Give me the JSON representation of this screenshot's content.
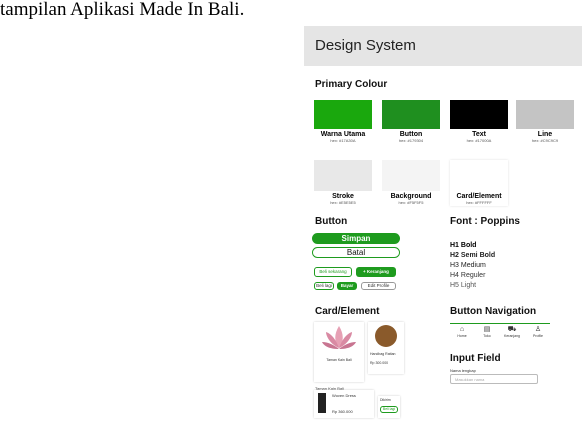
{
  "caption": "tampilan Aplikasi Made In Bali.",
  "header": {
    "title": "Design System"
  },
  "primary_colour": {
    "heading": "Primary Colour",
    "swatches": [
      {
        "name": "Warna Utama",
        "hex": "hex: #17A30A",
        "color": "#1aa80d"
      },
      {
        "name": "Button",
        "hex": "hex: #179304",
        "color": "#1f8f1f"
      },
      {
        "name": "Text",
        "hex": "hex: #17000A",
        "color": "#000000"
      },
      {
        "name": "Line",
        "hex": "hex: #C9C9C9",
        "color": "#c4c4c4"
      },
      {
        "name": "Stroke",
        "hex": "hex: #E5E5E5",
        "color": "#e8e8e8"
      },
      {
        "name": "Background",
        "hex": "hex: #F5F5F5",
        "color": "#f4f4f4"
      },
      {
        "name": "Card/Element",
        "hex": "hex: #FFFFFF",
        "color": "#ffffff"
      }
    ]
  },
  "button_section": {
    "heading": "Button",
    "simpan": "Simpan",
    "batal": "Batal",
    "belanja": "Beli sekarang",
    "keranjang": "+ Keranjang",
    "small1": "Beli lagi",
    "small2": "Bayar",
    "edit": "Edit Profile"
  },
  "font_section": {
    "heading": "Font : Poppins",
    "h1": "H1 Bold",
    "h2": "H2 Semi Bold",
    "h3": "H3 Medium",
    "h4": "H4 Reguler",
    "h5": "H5 Light"
  },
  "card_section": {
    "heading": "Card/Element",
    "shop_name": "Taman Kain Bali",
    "shop_location": "Jalan Teuku Umar",
    "product_name": "Handbag Rattan",
    "product_price": "Rp 300.000",
    "dress_name": "Woven Dress",
    "dress_price": "Rp 360.000",
    "dress_btn": "Beli lagi",
    "order_status": "Dikirim"
  },
  "nav_section": {
    "heading": "Button Navigation",
    "items": [
      {
        "icon": "home-icon",
        "glyph": "⌂",
        "label": "Home"
      },
      {
        "icon": "store-icon",
        "glyph": "▤",
        "label": "Toko"
      },
      {
        "icon": "cart-icon",
        "glyph": "⛟",
        "label": "Keranjang"
      },
      {
        "icon": "profile-icon",
        "glyph": "♙",
        "label": "Profile"
      }
    ]
  },
  "input_section": {
    "heading": "Input Field",
    "label": "Nama lengkap",
    "placeholder": "Masukkan nama"
  }
}
